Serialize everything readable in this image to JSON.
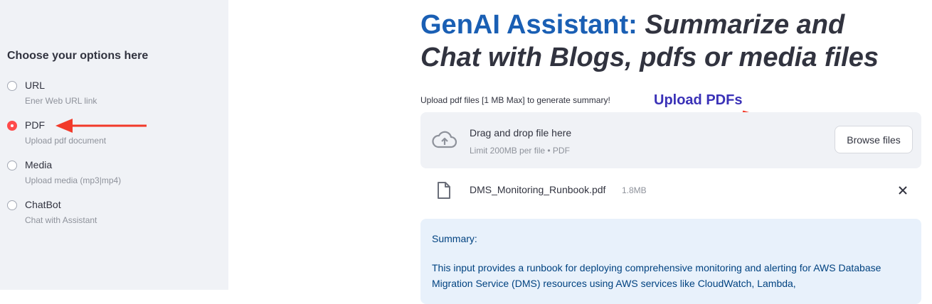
{
  "sidebar": {
    "heading": "Choose your options here",
    "options": [
      {
        "label": "URL",
        "caption": "Ener Web URL link",
        "selected": false
      },
      {
        "label": "PDF",
        "caption": "Upload pdf document",
        "selected": true
      },
      {
        "label": "Media",
        "caption": "Upload media (mp3|mp4)",
        "selected": false
      },
      {
        "label": "ChatBot",
        "caption": "Chat with Assistant",
        "selected": false
      }
    ]
  },
  "main": {
    "title": {
      "accent": "GenAI Assistant:",
      "italic_line1": "Summarize and",
      "italic_line2": "Chat with Blogs, pdfs or media files"
    },
    "upload_caption": "Upload pdf files [1 MB Max] to generate summary!",
    "annotation_label": "Upload PDFs",
    "dropzone": {
      "title": "Drag and drop file here",
      "limit": "Limit 200MB per file • PDF",
      "browse_label": "Browse files",
      "icon": "cloud-upload-icon"
    },
    "file": {
      "name": "DMS_Monitoring_Runbook.pdf",
      "size": "1.8MB",
      "icon": "file-icon",
      "remove_icon": "close-icon"
    },
    "summary": {
      "heading": "Summary:",
      "text": "This input provides a runbook for deploying comprehensive monitoring and alerting for AWS Database Migration Service (DMS) resources using AWS services like CloudWatch, Lambda,"
    }
  },
  "colors": {
    "accent": "#1a5fb4",
    "radio_selected": "#ff4b4b",
    "annotation_arrow": "#f23a2a",
    "annotation_text": "#3a31b7",
    "summary_text": "#004280",
    "summary_bg": "#e8f1fb",
    "sidebar_bg": "#f0f2f6"
  }
}
